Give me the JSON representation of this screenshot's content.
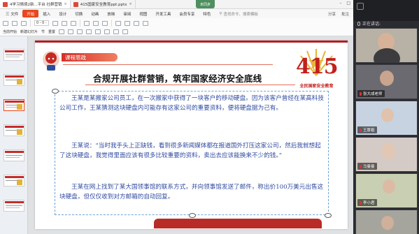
{
  "tabs": [
    {
      "label": "4学习情境2新...平台 社群营销",
      "active": true
    },
    {
      "label": "415国家安全教育ppt.pptx",
      "active": false
    }
  ],
  "cloud_badge": "未同步",
  "menu": {
    "items": [
      "三 文件",
      "开始",
      "插入",
      "设计",
      "切换",
      "动画",
      "放映",
      "审阅",
      "视图",
      "开发工具",
      "会员专享",
      "特色"
    ],
    "search_placeholder": "查找命令、搜索模板",
    "right": [
      "分享",
      "批注"
    ]
  },
  "toolbar": {
    "row1": [
      "当前开始",
      "新建幻灯片",
      "版式"
    ],
    "row2": [
      "新建幻灯片",
      "节",
      "重置"
    ],
    "font_box": "0 - 0 -"
  },
  "slide": {
    "chapter_label": "课程思政",
    "title": "合规开展社群营销，筑牢国家经济安全底线",
    "logo_number": "415",
    "logo_subtitle": "全民国家安全教育",
    "paragraphs": [
      "王某是某搬家公司员工，在一次搬家中获得了一块客户的移动硬盘。因为该客户曾经在某高科技公司工作，王某猜测这块硬盘内可能存有这家公司的重要资料，便将硬盘据为己有。",
      "王某说：“当时我手头上正缺钱，看到很多新闻媒体都在报道国外打压这家公司，然后我就想起了这块硬盘，我觉得里面应该有很多比较重要的资料，卖出去应该能换来不少的钱。”",
      "王某在网上找到了某大国领事馆的联系方式，并向领事馆发送了邮件，称出价100万美元出售这块硬盘，但仅仅收到对方邮箱的自动回复。"
    ]
  },
  "meeting": {
    "speaking_label": "正在讲话:",
    "participants": [
      {
        "name": "",
        "bg": "#b7b1a6"
      },
      {
        "name": "张大成老师",
        "bg": "#8d8c93"
      },
      {
        "name": "王厚祖",
        "bg": "#c8d3e1"
      },
      {
        "name": "马曼曼",
        "bg": "#d5cbc6"
      },
      {
        "name": "李小君",
        "bg": "#c9cfb2"
      },
      {
        "name": "孙韩",
        "bg": "#a5a59e"
      }
    ]
  }
}
